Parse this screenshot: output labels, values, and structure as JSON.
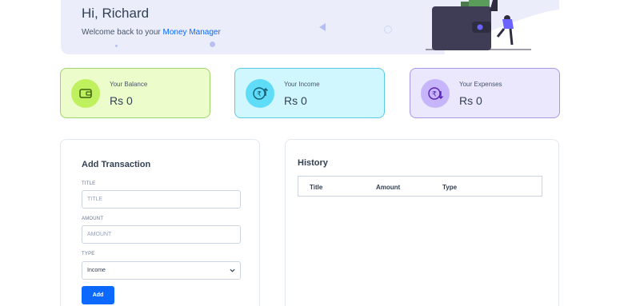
{
  "banner": {
    "greeting": "Hi, Richard",
    "welcome_text": "Welcome back to your ",
    "brand": "Money Manager"
  },
  "stats": [
    {
      "label": "Your Balance",
      "value": "Rs 0",
      "icon": "wallet-icon"
    },
    {
      "label": "Your Income",
      "value": "Rs 0",
      "icon": "rupee-income-icon"
    },
    {
      "label": "Your Expenses",
      "value": "Rs 0",
      "icon": "rupee-expense-icon"
    }
  ],
  "transaction_form": {
    "heading": "Add Transaction",
    "title_label": "TITLE",
    "title_placeholder": "TITLE",
    "amount_label": "AMOUNT",
    "amount_placeholder": "AMOUNT",
    "type_label": "TYPE",
    "type_selected": "Income",
    "add_label": "Add"
  },
  "history": {
    "heading": "History",
    "columns": [
      "Title",
      "Amount",
      "Type"
    ]
  },
  "colors": {
    "primary": "#0b69ff",
    "balance_bg": "#ecfcca",
    "income_bg": "#cff7fd",
    "expenses_bg": "#ebe7fd"
  }
}
